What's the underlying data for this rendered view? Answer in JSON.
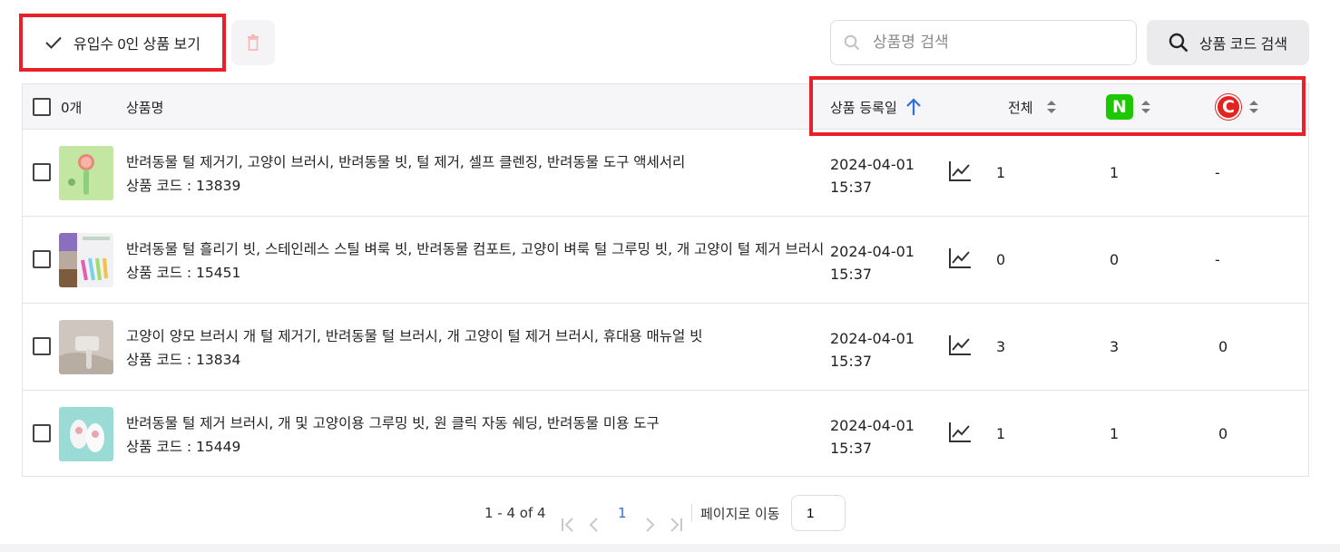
{
  "toolbar": {
    "zero_filter_label": "유입수 0인 상품 보기",
    "search_placeholder": "상품명 검색",
    "code_search_label": "상품 코드 검색"
  },
  "table": {
    "headers": {
      "count": "0개",
      "name": "상품명",
      "date": "상품 등록일",
      "total": "전체",
      "naver_badge": "N",
      "coupang_badge": "C"
    },
    "rows": [
      {
        "name": "반려동물 털 제거기, 고양이 브러시, 반려동물 빗, 털 제거, 셀프 클렌징, 반려동물 도구 액세서리",
        "code": "상품 코드 : 13839",
        "date": "2024-04-01",
        "time": "15:37",
        "total": "1",
        "naver": "1",
        "coupang": "-"
      },
      {
        "name": "반려동물 털 흘리기 빗, 스테인레스 스틸 벼룩 빗, 반려동물 컴포트, 고양이 벼룩 털 그루밍 빗, 개 고양이 털 제거 브러시",
        "code": "상품 코드 : 15451",
        "date": "2024-04-01",
        "time": "15:37",
        "total": "0",
        "naver": "0",
        "coupang": "-"
      },
      {
        "name": "고양이 양모 브러시 개 털 제거기, 반려동물 털 브러시, 개 고양이 털 제거 브러시, 휴대용 매뉴얼 빗",
        "code": "상품 코드 : 13834",
        "date": "2024-04-01",
        "time": "15:37",
        "total": "3",
        "naver": "3",
        "coupang": "0"
      },
      {
        "name": "반려동물 털 제거 브러시, 개 및 고양이용 그루밍 빗, 원 클릭 자동 쉐딩, 반려동물 미용 도구",
        "code": "상품 코드 : 15449",
        "date": "2024-04-01",
        "time": "15:37",
        "total": "1",
        "naver": "1",
        "coupang": "0"
      }
    ]
  },
  "pagination": {
    "range": "1 - 4 of 4",
    "current_page": "1",
    "goto_label": "페이지로 이동",
    "goto_value": "1"
  },
  "colors": {
    "highlight": "#e8202a",
    "naver_green": "#1ec800",
    "coupang_red": "#e4231f",
    "link_blue": "#2f6fe0"
  }
}
